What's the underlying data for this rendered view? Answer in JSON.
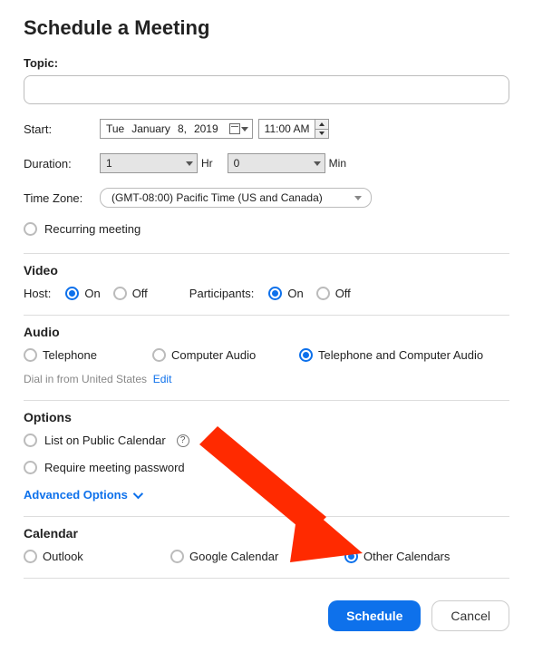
{
  "title": "Schedule a Meeting",
  "topic": {
    "label": "Topic:",
    "value": ""
  },
  "start": {
    "label": "Start:",
    "weekday": "Tue",
    "month": "January",
    "day": "8,",
    "year": "2019",
    "time": "11:00 AM"
  },
  "duration": {
    "label": "Duration:",
    "hours": "1",
    "hours_unit": "Hr",
    "minutes": "0",
    "minutes_unit": "Min"
  },
  "timezone": {
    "label": "Time Zone:",
    "value": "(GMT-08:00) Pacific Time (US and Canada)"
  },
  "recurring_label": "Recurring meeting",
  "video": {
    "title": "Video",
    "host_label": "Host:",
    "participants_label": "Participants:",
    "on": "On",
    "off": "Off"
  },
  "audio": {
    "title": "Audio",
    "telephone": "Telephone",
    "computer": "Computer Audio",
    "both": "Telephone and Computer Audio",
    "dialin_text": "Dial in from United States",
    "edit": "Edit"
  },
  "options": {
    "title": "Options",
    "public": "List on Public Calendar",
    "password": "Require meeting password",
    "advanced": "Advanced Options"
  },
  "calendar": {
    "title": "Calendar",
    "outlook": "Outlook",
    "google": "Google Calendar",
    "other": "Other Calendars"
  },
  "buttons": {
    "schedule": "Schedule",
    "cancel": "Cancel"
  }
}
